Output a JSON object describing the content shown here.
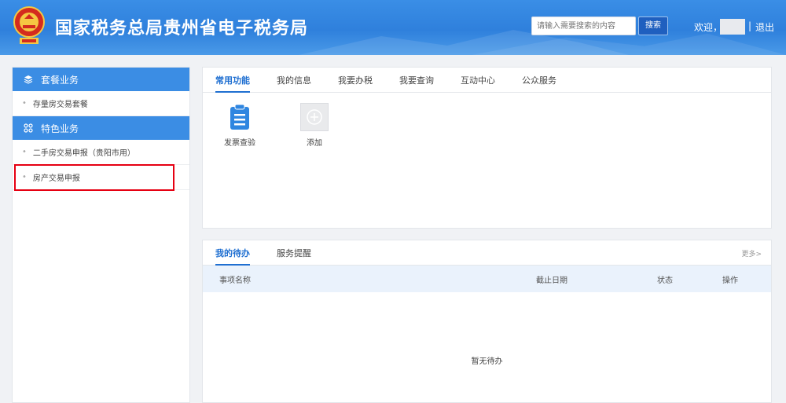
{
  "header": {
    "title": "国家税务总局贵州省电子税务局",
    "search_placeholder": "请输入需要搜索的内容",
    "search_button": "搜索",
    "welcome": "欢迎，",
    "separator": "|",
    "logout": "退出",
    "emblem_icon": "tax-emblem-icon",
    "colors": {
      "header_bg": "#2f80dc",
      "accent": "#1f6fd1",
      "highlight": "#e60012"
    }
  },
  "sidebar": {
    "section1": {
      "label": "套餐业务",
      "icon": "layers-icon"
    },
    "section1_items": [
      {
        "label": "存量房交易套餐"
      }
    ],
    "section2": {
      "label": "特色业务",
      "icon": "grid-icon"
    },
    "section2_items": [
      {
        "label": "二手房交易申报（贵阳市用）"
      },
      {
        "label": "房产交易申报"
      }
    ]
  },
  "top_panel": {
    "tabs": [
      "常用功能",
      "我的信息",
      "我要办税",
      "我要查询",
      "互动中心",
      "公众服务"
    ],
    "active_tab": 0,
    "functions": [
      {
        "label": "发票查验",
        "icon": "clipboard-icon"
      },
      {
        "label": "添加",
        "icon": "plus-icon"
      }
    ]
  },
  "bottom_panel": {
    "tabs": [
      "我的待办",
      "服务提醒"
    ],
    "active_tab": 0,
    "more": "更多>",
    "columns": [
      "事项名称",
      "截止日期",
      "状态",
      "操作"
    ],
    "empty_text": "暂无待办"
  }
}
